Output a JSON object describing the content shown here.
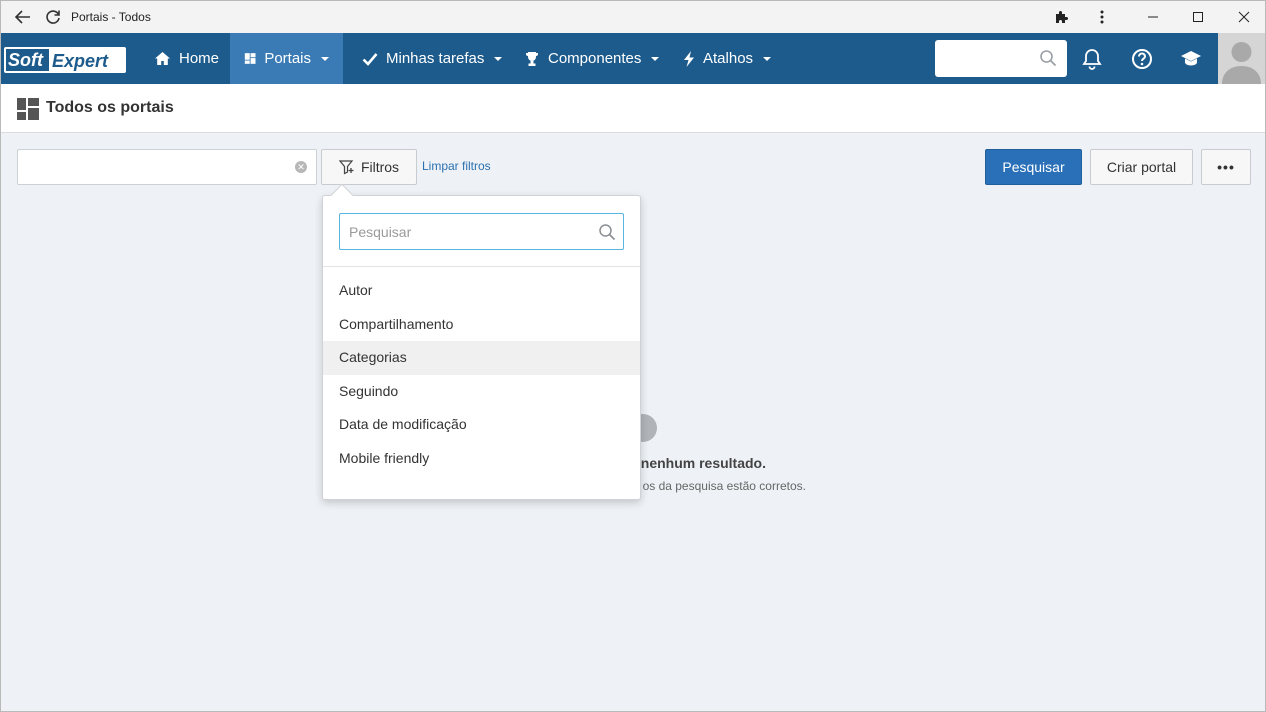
{
  "browser": {
    "title": "Portais - Todos"
  },
  "nav": {
    "logo_text_1": "Soft",
    "logo_text_2": "Expert",
    "items": [
      {
        "label": "Home",
        "icon": "home-icon"
      },
      {
        "label": "Portais",
        "icon": "dashboard-icon",
        "active": true
      },
      {
        "label": "Minhas tarefas",
        "icon": "check-icon"
      },
      {
        "label": "Componentes",
        "icon": "trophy-icon"
      },
      {
        "label": "Atalhos",
        "icon": "bolt-icon"
      }
    ],
    "search_value": "",
    "colors": {
      "bar": "#1d5b8c",
      "active": "#3a7bb5"
    }
  },
  "page": {
    "title": "Todos os portais"
  },
  "toolbar": {
    "search_value": "",
    "filter_label": "Filtros",
    "clear_filters_label": "Limpar filtros",
    "search_button": "Pesquisar",
    "create_button": "Criar portal",
    "more_button": "•••"
  },
  "empty_state": {
    "title": "nenhum resultado.",
    "subtitle": "os da pesquisa estão corretos."
  },
  "filter_menu": {
    "search_placeholder": "Pesquisar",
    "items": [
      "Autor",
      "Compartilhamento",
      "Categorias",
      "Seguindo",
      "Data de modificação",
      "Mobile friendly"
    ],
    "hovered_item": "Categorias"
  }
}
